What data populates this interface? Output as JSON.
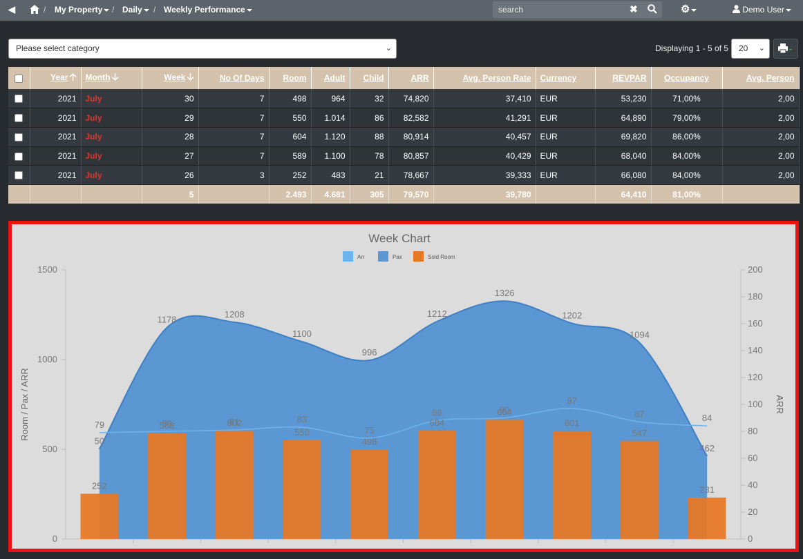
{
  "nav": {
    "breadcrumbs": [
      "My Property",
      "Daily",
      "Weekly Performance"
    ],
    "search_placeholder": "search",
    "user": "Demo User"
  },
  "toolbar": {
    "category_placeholder": "Please select category",
    "displaying": "Displaying 1 - 5 of 5",
    "page_size": "20"
  },
  "table": {
    "headers": [
      "Year",
      "Month",
      "Week",
      "No Of Days",
      "Room",
      "Adult",
      "Child",
      "ARR",
      "Avg. Person Rate",
      "Currency",
      "REVPAR",
      "Occupancy",
      "Avg. Person"
    ],
    "rows": [
      [
        "2021",
        "July",
        "30",
        "7",
        "498",
        "964",
        "32",
        "74,820",
        "37,410",
        "EUR",
        "53,230",
        "71,00%",
        "2,00"
      ],
      [
        "2021",
        "July",
        "29",
        "7",
        "550",
        "1.014",
        "86",
        "82,582",
        "41,291",
        "EUR",
        "64,890",
        "79,00%",
        "2,00"
      ],
      [
        "2021",
        "July",
        "28",
        "7",
        "604",
        "1.120",
        "88",
        "80,914",
        "40,457",
        "EUR",
        "69,820",
        "86,00%",
        "2,00"
      ],
      [
        "2021",
        "July",
        "27",
        "7",
        "589",
        "1.100",
        "78",
        "80,857",
        "40,429",
        "EUR",
        "68,040",
        "84,00%",
        "2,00"
      ],
      [
        "2021",
        "July",
        "26",
        "3",
        "252",
        "483",
        "21",
        "78,667",
        "39,333",
        "EUR",
        "66,080",
        "84,00%",
        "2,00"
      ]
    ],
    "totals": [
      "",
      "",
      "5",
      "",
      "2.493",
      "4.681",
      "305",
      "79,570",
      "39,780",
      "",
      "64,410",
      "81,00%",
      ""
    ]
  },
  "colors": {
    "header_bg": "#d4c2ad",
    "month_text": "#e4332a",
    "pax_area": "#5b97d3",
    "sold_room_bar": "#e87722",
    "arr_line": "#6cb4ee",
    "panel_border": "#ee1111"
  },
  "chart_data": {
    "type": "bar",
    "title": "Week Chart",
    "ylabel_left": "Room / Pax / ARR",
    "ylabel_right": "ARR",
    "y_left_range": [
      0,
      1500
    ],
    "y_left_ticks": [
      "0",
      "500",
      "1000",
      "1500"
    ],
    "y_right_range": [
      0,
      200
    ],
    "y_right_ticks": [
      "0",
      "20",
      "40",
      "60",
      "80",
      "100",
      "120",
      "140",
      "160",
      "180",
      "200"
    ],
    "legend": [
      "Arr",
      "Pax",
      "Sold Room"
    ],
    "legend_position": "top-center",
    "series": [
      {
        "name": "Pax",
        "type": "area",
        "axis": "left",
        "values": [
          501,
          1178,
          1208,
          1100,
          996,
          1212,
          1326,
          1202,
          1094,
          462
        ]
      },
      {
        "name": "Sold Room",
        "type": "bar",
        "axis": "left",
        "values": [
          252,
          588,
          602,
          550,
          498,
          604,
          664,
          601,
          547,
          231
        ]
      },
      {
        "name": "Arr",
        "type": "line",
        "axis": "right",
        "values": [
          79,
          80,
          81,
          83,
          75,
          88,
          90,
          97,
          87,
          84
        ]
      }
    ],
    "labels": {
      "pax": [
        "50",
        "1178",
        "1208",
        "1100",
        "996",
        "1212",
        "1326",
        "1202",
        "1094",
        "462"
      ],
      "sold_room": [
        "252",
        "588",
        "602",
        "550",
        "498",
        "604",
        "664",
        "601",
        "547",
        "231"
      ],
      "arr": [
        "79",
        "80",
        "81",
        "83",
        "75",
        "88",
        "90",
        "97",
        "87",
        "84"
      ]
    }
  }
}
